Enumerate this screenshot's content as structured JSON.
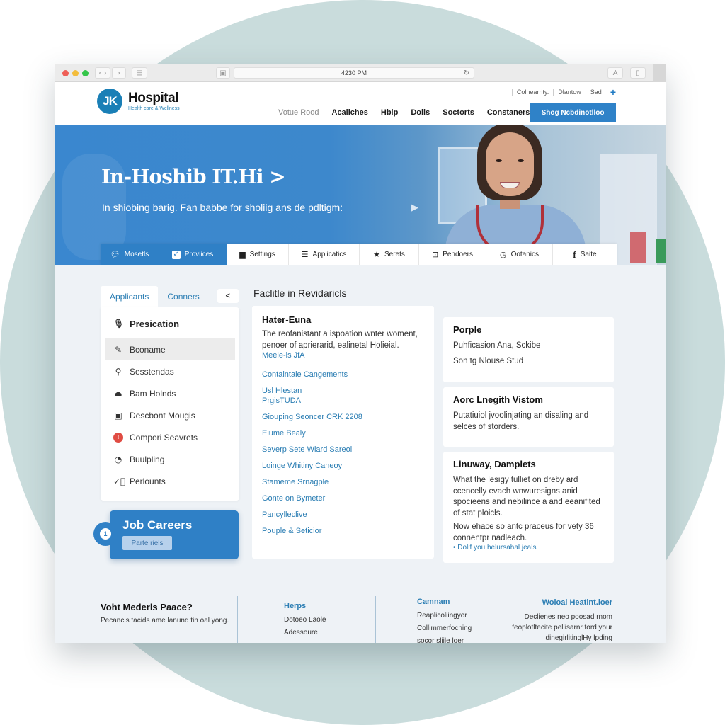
{
  "browser": {
    "address_text": "4230 PM",
    "reader_label": "A"
  },
  "header": {
    "logo_initials": "JK",
    "logo_name": "Hospital",
    "logo_tagline": "Health care & Wellness",
    "util_links": [
      "Colnearrity.",
      "Dlantow",
      "Sad"
    ],
    "nav": [
      {
        "label": "Votue Rood",
        "muted": true
      },
      {
        "label": "Acaiiches"
      },
      {
        "label": "Hbip"
      },
      {
        "label": "Dolls"
      },
      {
        "label": "Soctorts"
      },
      {
        "label": "Constaners"
      }
    ],
    "cta_label": "Shog Ncbdinotlloo"
  },
  "hero": {
    "title": "In-Hoshib IT.Hi >",
    "subtitle": "In shiobing barig. Fan babbe for sholiig ans de pdltigm:"
  },
  "tabs": [
    {
      "label": "Mosetls",
      "icon": "chat-icon",
      "active": true
    },
    {
      "label": "Proviices",
      "icon": "checkbox-icon",
      "active": true
    },
    {
      "label": "Settings",
      "icon": "clipboard-icon"
    },
    {
      "label": "Applicatics",
      "icon": "list-icon"
    },
    {
      "label": "Serets",
      "icon": "star-icon"
    },
    {
      "label": "Pendoers",
      "icon": "badge-icon"
    },
    {
      "label": "Ootanics",
      "icon": "clock-icon"
    },
    {
      "label": "Saite",
      "icon": "facebook-icon"
    }
  ],
  "sidebar": {
    "tabs": [
      "Applicants",
      "Conners"
    ],
    "collapse_label": "<",
    "header": "Presication",
    "items": [
      {
        "label": "Bconame",
        "icon": "pencil-icon",
        "selected": true
      },
      {
        "label": "Sesstendas",
        "icon": "location-pin-icon"
      },
      {
        "label": "Bam Holnds",
        "icon": "bell-icon"
      },
      {
        "label": "Descbont Mougis",
        "icon": "document-icon"
      },
      {
        "label": "Compori Seavrets",
        "icon": "alert-badge-icon",
        "badge": "!"
      },
      {
        "label": "Buulpling",
        "icon": "clock-icon"
      },
      {
        "label": "Perlounts",
        "icon": "check-circle-icon"
      }
    ]
  },
  "job_card": {
    "badge": "1",
    "title": "Job Careers",
    "button_label": "Parte riels"
  },
  "middle": {
    "section_title": "Faclitle in Revidaricls",
    "card_title": "Hater-Euna",
    "description": "The reofanistant a ispoation wnter woment, penoer of aprierarid, ealinetal Holieial.",
    "first_link": "Meele-is JfA",
    "links": [
      "Contalntale Cangements",
      "Usl Hlestan PrgisTUDA",
      "Giouping Seoncer CRK 2208",
      "Eiume Bealy",
      "Severp Sete Wiard Sareol",
      "Loinge Whitiny Caneoy",
      "Stameme Srnagple",
      "Gonte on Bymeter",
      "Pancylleclive",
      "Pouple & Seticior"
    ]
  },
  "right": {
    "card1": {
      "title": "Porple",
      "lines": [
        "Puhficasion Ana, Sckibe",
        "Son tg Nlouse Stud"
      ]
    },
    "card2": {
      "title": "Aorc Lnegith Vistom",
      "text": "Putatiuiol jvoolinjating an disaling and selces of storders."
    },
    "card3": {
      "title": "Linuway, Damplets",
      "text1": "What the lesigy tulliet on dreby ard ccencelly evach wnwuresigns anid spocieens and nebilince a and eeanifited of stat ploicls.",
      "text2": "Now ehace so antc praceus for vety 36 connentpr nadleach.",
      "link": "• Dolif you helursahal jeals"
    }
  },
  "footer": {
    "col1": {
      "title": "Voht Mederls Paace?",
      "text": "Pecancls tacids ame lanund tin oal yong."
    },
    "col2": {
      "title": "Herps",
      "items": [
        "Dotoeo Laole",
        "Adessoure"
      ]
    },
    "col3": {
      "title": "Camnam",
      "items": [
        "Reaplicoliingyor",
        "Collimmerfoching",
        "socor sliile loer"
      ]
    },
    "col4": {
      "title": "Woloal Heatlnt.loer",
      "text": [
        "Declienes neo poosad rnom",
        "feoplotltecite pellisarnr tord your",
        "dinegirlitinglHy lpding"
      ]
    }
  },
  "colors": {
    "brand_blue": "#2f80c6",
    "link_blue": "#2a7db3",
    "alert_red": "#e04c43",
    "background_circle": "#c9dcdc"
  }
}
